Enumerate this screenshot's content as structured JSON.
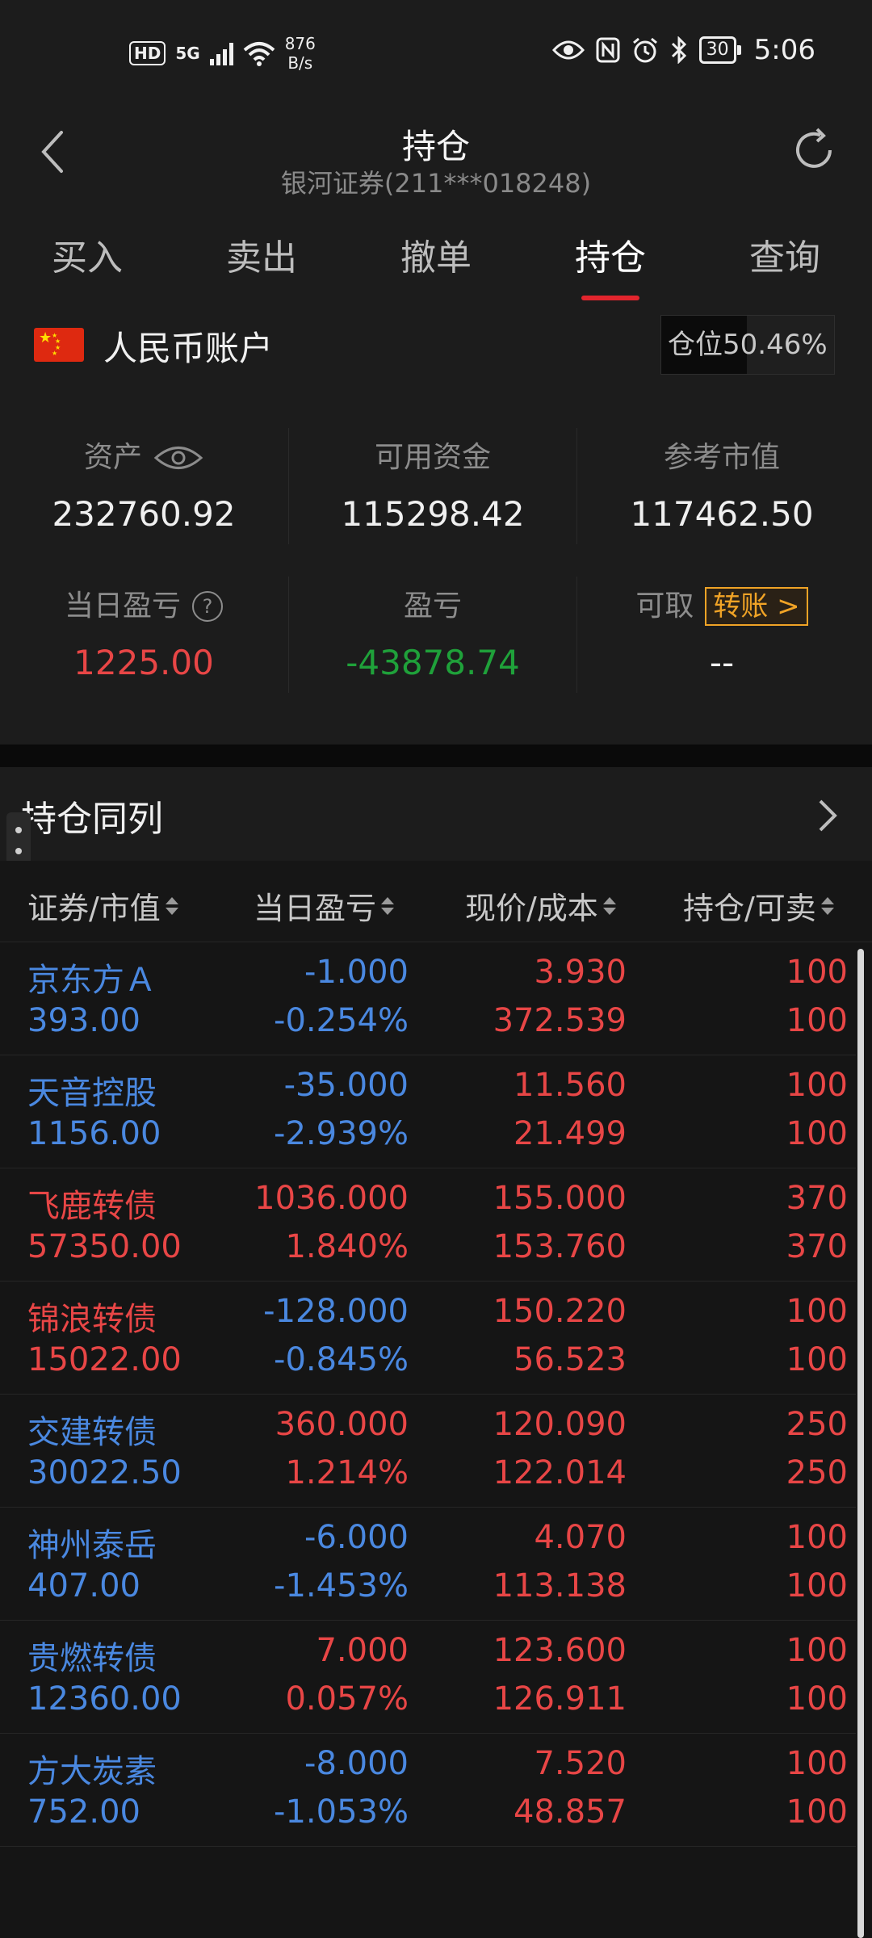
{
  "status_bar": {
    "hd": "HD",
    "network": "5G",
    "speed_value": "876",
    "speed_unit": "B/s",
    "battery": "30",
    "time": "5:06"
  },
  "header": {
    "title": "持仓",
    "subtitle": "银河证券(211***018248)"
  },
  "tabs": [
    {
      "label": "买入"
    },
    {
      "label": "卖出"
    },
    {
      "label": "撤单"
    },
    {
      "label": "持仓",
      "active": true
    },
    {
      "label": "查询"
    }
  ],
  "account": {
    "label": "人民币账户",
    "position_label": "仓位",
    "position_value": "50.46%"
  },
  "summary": {
    "assets_label": "资产",
    "assets_value": "232760.92",
    "available_label": "可用资金",
    "available_value": "115298.42",
    "market_value_label": "参考市值",
    "market_value": "117462.50",
    "daily_pl_label": "当日盈亏",
    "daily_pl_help": "?",
    "daily_pl_value": "1225.00",
    "pl_label": "盈亏",
    "pl_value": "-43878.74",
    "withdrawable_label": "可取",
    "transfer_label": "转账 >",
    "withdrawable_value": "--"
  },
  "list": {
    "title": "持仓同列",
    "columns": [
      "证券/市值",
      "当日盈亏",
      "现价/成本",
      "持仓/可卖"
    ],
    "rows": [
      {
        "name": "京东方Ａ",
        "mv": "393.00",
        "pl": "-1.000",
        "plpct": "-0.254%",
        "price": "3.930",
        "cost": "372.539",
        "hold": "100",
        "sell": "100",
        "color": "blue"
      },
      {
        "name": "天音控股",
        "mv": "1156.00",
        "pl": "-35.000",
        "plpct": "-2.939%",
        "price": "11.560",
        "cost": "21.499",
        "hold": "100",
        "sell": "100",
        "color": "blue"
      },
      {
        "name": "飞鹿转债",
        "mv": "57350.00",
        "pl": "1036.000",
        "plpct": "1.840%",
        "price": "155.000",
        "cost": "153.760",
        "hold": "370",
        "sell": "370",
        "color": "red"
      },
      {
        "name": "锦浪转债",
        "mv": "15022.00",
        "pl": "-128.000",
        "plpct": "-0.845%",
        "price": "150.220",
        "cost": "56.523",
        "hold": "100",
        "sell": "100",
        "color": "red"
      },
      {
        "name": "交建转债",
        "mv": "30022.50",
        "pl": "360.000",
        "plpct": "1.214%",
        "price": "120.090",
        "cost": "122.014",
        "hold": "250",
        "sell": "250",
        "color": "blue"
      },
      {
        "name": "神州泰岳",
        "mv": "407.00",
        "pl": "-6.000",
        "plpct": "-1.453%",
        "price": "4.070",
        "cost": "113.138",
        "hold": "100",
        "sell": "100",
        "color": "blue"
      },
      {
        "name": "贵燃转债",
        "mv": "12360.00",
        "pl": "7.000",
        "plpct": "0.057%",
        "price": "123.600",
        "cost": "126.911",
        "hold": "100",
        "sell": "100",
        "color": "blue"
      },
      {
        "name": "方大炭素",
        "mv": "752.00",
        "pl": "-8.000",
        "plpct": "-1.053%",
        "price": "7.520",
        "cost": "48.857",
        "hold": "100",
        "sell": "100",
        "color": "blue"
      }
    ]
  },
  "colors": {
    "up": "#e84646",
    "down": "#1fa13a",
    "neutral_name": "#4a88e0",
    "accent": "#e2252d",
    "transfer": "#f0a326"
  }
}
